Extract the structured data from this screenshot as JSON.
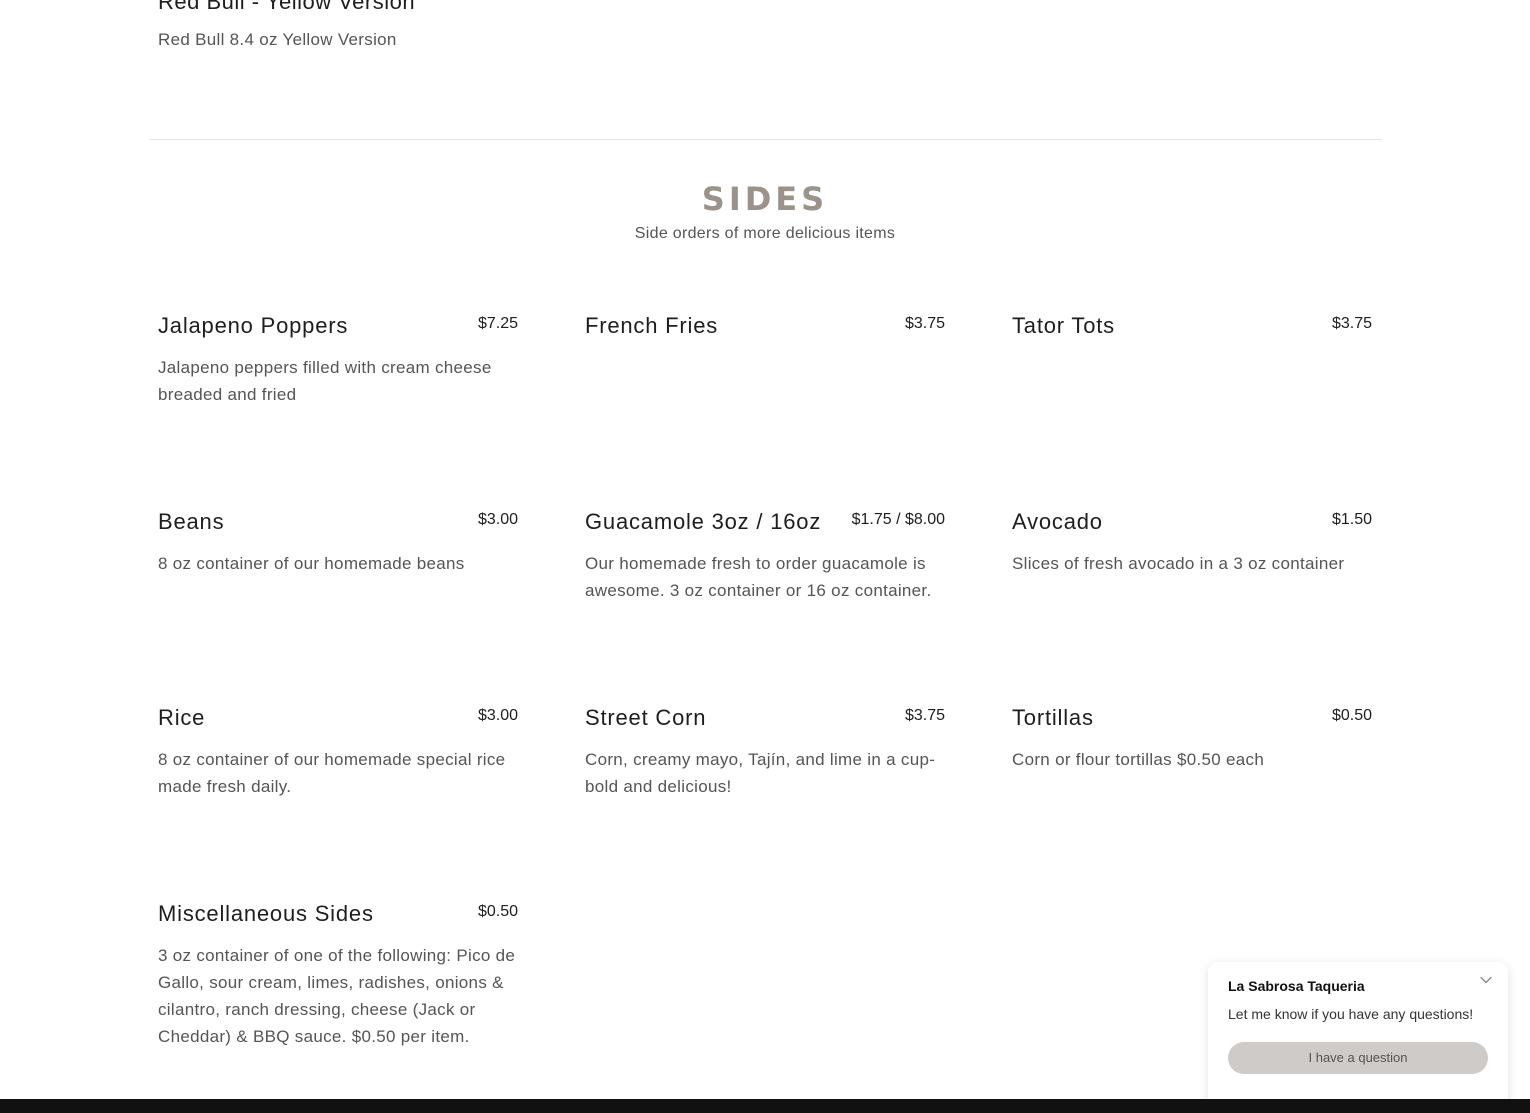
{
  "previous_item": {
    "title": "Red Bull - Yellow Version",
    "description": "Red Bull 8.4 oz Yellow Version"
  },
  "section": {
    "title": "SIDES",
    "subtitle": "Side orders of more delicious items"
  },
  "items": [
    {
      "name": "Jalapeno Poppers",
      "price": "$7.25",
      "description": "Jalapeno peppers filled with cream cheese breaded and fried"
    },
    {
      "name": "French Fries",
      "price": "$3.75",
      "description": ""
    },
    {
      "name": "Tator Tots",
      "price": "$3.75",
      "description": ""
    },
    {
      "name": "Beans",
      "price": "$3.00",
      "description": "8 oz container of our homemade beans"
    },
    {
      "name": "Guacamole 3oz / 16oz",
      "price": "$1.75 / $8.00",
      "description": "Our homemade fresh to order guacamole is awesome.  3 oz container or 16 oz container."
    },
    {
      "name": "Avocado",
      "price": "$1.50",
      "description": "Slices of fresh avocado in a 3 oz container"
    },
    {
      "name": "Rice",
      "price": "$3.00",
      "description": "8 oz container of our homemade special rice made fresh daily."
    },
    {
      "name": "Street Corn",
      "price": "$3.75",
      "description": " Corn, creamy mayo, Tajín, and lime in a cup-bold and delicious!"
    },
    {
      "name": "Tortillas",
      "price": "$0.50",
      "description": "Corn or flour tortillas $0.50 each"
    },
    {
      "name": "Miscellaneous Sides",
      "price": "$0.50",
      "description": "3 oz container of one of the following:  Pico de Gallo, sour cream, limes, radishes, onions & cilantro, ranch dressing, cheese (Jack or Cheddar) & BBQ sauce.  $0.50 per item."
    }
  ],
  "chat": {
    "business_name": "La Sabrosa Taqueria",
    "message": "Let me know if you have any questions!",
    "button_label": "I have a question",
    "close_icon": "chevron-down-icon"
  }
}
